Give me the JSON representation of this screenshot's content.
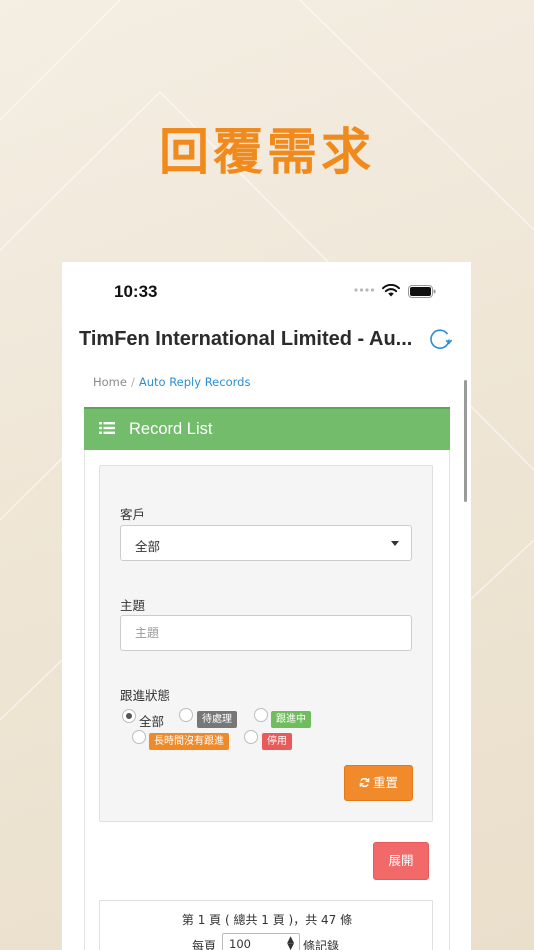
{
  "hero": {
    "title": "回覆需求"
  },
  "status_bar": {
    "time": "10:33"
  },
  "header": {
    "title": "TimFen International Limited - Au..."
  },
  "breadcrumb": {
    "home": "Home",
    "separator": "/",
    "current": "Auto Reply Records"
  },
  "panel": {
    "title": "Record List"
  },
  "filters": {
    "customer_label": "客戶",
    "customer_value": "全部",
    "subject_label": "主題",
    "subject_value": "",
    "subject_placeholder": "主題",
    "status_label": "跟進狀態",
    "status_options": [
      {
        "label": "全部",
        "selected": true
      },
      {
        "label": "待處理",
        "color": "#777777"
      },
      {
        "label": "跟進中",
        "color": "#6fbd5c"
      },
      {
        "label": "長時間沒有跟進",
        "color": "#ee8a2a"
      },
      {
        "label": "停用",
        "color": "#e95b5b"
      }
    ],
    "reset_label": "重置"
  },
  "actions": {
    "expand_label": "展開"
  },
  "pagination": {
    "summary": "第 1 頁 ( 總共 1 頁 )，共 47 條",
    "per_page_label": "每頁",
    "per_page_value": "100",
    "per_page_suffix": "條記錄"
  },
  "colors": {
    "accent": "#f08a1c",
    "panel_header": "#72bc6b",
    "link": "#2a8fd0",
    "reset_button": "#f08a2a",
    "expand_button": "#f2696a"
  }
}
